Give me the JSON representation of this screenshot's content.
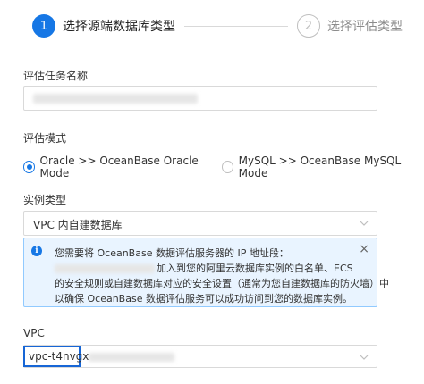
{
  "steps": [
    {
      "number": "1",
      "title": "选择源端数据库类型"
    },
    {
      "number": "2",
      "title": "选择评估类型"
    }
  ],
  "task_name": {
    "label": "评估任务名称"
  },
  "mode": {
    "label": "评估模式",
    "options": [
      {
        "label": "Oracle >> OceanBase Oracle Mode",
        "checked": true
      },
      {
        "label": "MySQL >> OceanBase MySQL Mode",
        "checked": false
      }
    ]
  },
  "instance": {
    "label": "实例类型",
    "value": "VPC 内自建数据库"
  },
  "alert": {
    "line1": "您需要将 OceanBase 数据评估服务器的 IP 地址段：",
    "line2": "加入到您的阿里云数据库实例的白名单、ECS",
    "line3": "的安全规则或自建数据库对应的安全设置（通常为您自建数据库的防火墙）中",
    "line4": "以确保 OceanBase 数据评估服务可以成功访问到您的数据库实例。",
    "close": "×",
    "icon": "i"
  },
  "vpc": {
    "label": "VPC",
    "value": "vpc-t4nvgx"
  },
  "colors": {
    "primary": "#1677e5",
    "alert_bg": "#e9f4ff",
    "alert_border": "#91caff",
    "highlight_border": "#1766d6"
  }
}
